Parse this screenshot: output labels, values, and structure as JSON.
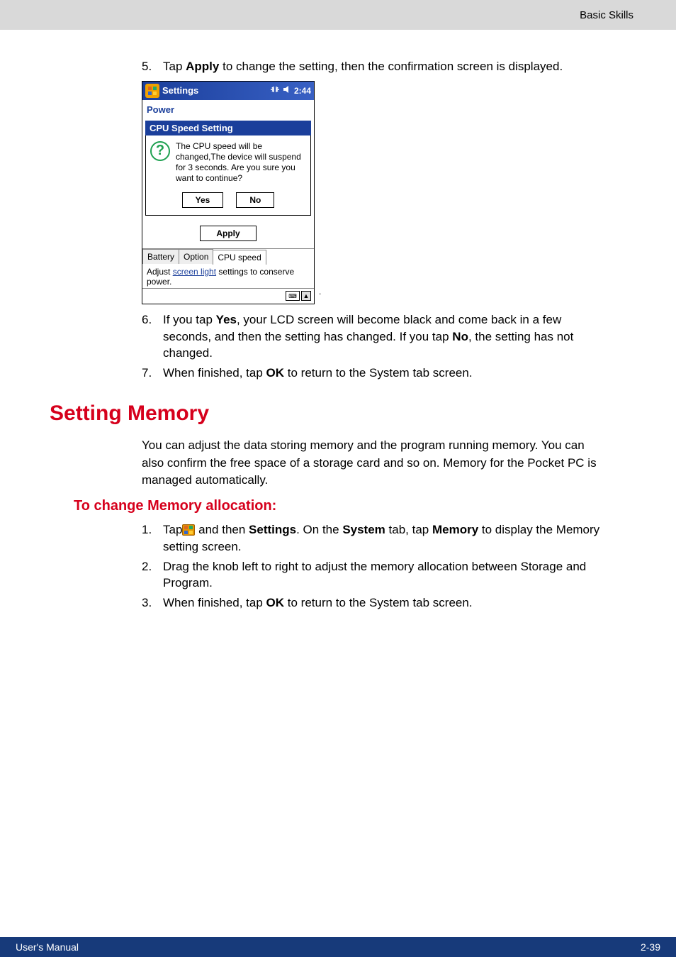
{
  "header": {
    "breadcrumb": "Basic Skills"
  },
  "steps_top": [
    {
      "num": "5.",
      "pre": "Tap ",
      "bold": "Apply",
      "post": " to change the setting, then the confirmation screen is displayed."
    }
  ],
  "screenshot": {
    "titlebar": {
      "title": "Settings",
      "time": "2:44"
    },
    "section_label": "Power",
    "dialog_title": "CPU Speed Setting",
    "dialog_message": "The CPU speed will be changed,The device will suspend for 3 seconds. Are you sure you want to continue?",
    "yes": "Yes",
    "no": "No",
    "apply": "Apply",
    "tabs": [
      "Battery",
      "Option",
      "CPU speed"
    ],
    "hint_pre": "Adjust ",
    "hint_link": "screen light",
    "hint_post": " settings to conserve power."
  },
  "right_dot": ".",
  "steps_mid": [
    {
      "num": "6.",
      "parts": [
        {
          "t": "If you tap "
        },
        {
          "b": "Yes"
        },
        {
          "t": ", your LCD screen will become black and come back in a few seconds, and then the setting has changed. If you tap "
        },
        {
          "b": "No"
        },
        {
          "t": ", the setting has not changed."
        }
      ]
    },
    {
      "num": "7.",
      "parts": [
        {
          "t": "When finished, tap "
        },
        {
          "b": "OK"
        },
        {
          "t": " to return to the System tab screen."
        }
      ]
    }
  ],
  "h1": "Setting Memory",
  "para": "You can adjust the data storing memory and the program running memory. You can also confirm the free space of a storage card and so on. Memory for the Pocket PC is managed automatically.",
  "h2": "To change Memory allocation:",
  "steps_bottom": [
    {
      "num": "1.",
      "parts": [
        {
          "t": "Tap"
        },
        {
          "icon": true
        },
        {
          "t": " and then "
        },
        {
          "b": "Settings"
        },
        {
          "t": ". On the "
        },
        {
          "b": "System"
        },
        {
          "t": " tab, tap "
        },
        {
          "b": "Memory"
        },
        {
          "t": " to display the Memory setting screen."
        }
      ]
    },
    {
      "num": "2.",
      "parts": [
        {
          "t": "Drag the knob left to right to adjust the memory allocation between Storage and Program."
        }
      ]
    },
    {
      "num": "3.",
      "parts": [
        {
          "t": "When finished, tap "
        },
        {
          "b": "OK"
        },
        {
          "t": " to return to the System tab screen."
        }
      ]
    }
  ],
  "footer": {
    "left": "User's Manual",
    "right": "2-39"
  }
}
